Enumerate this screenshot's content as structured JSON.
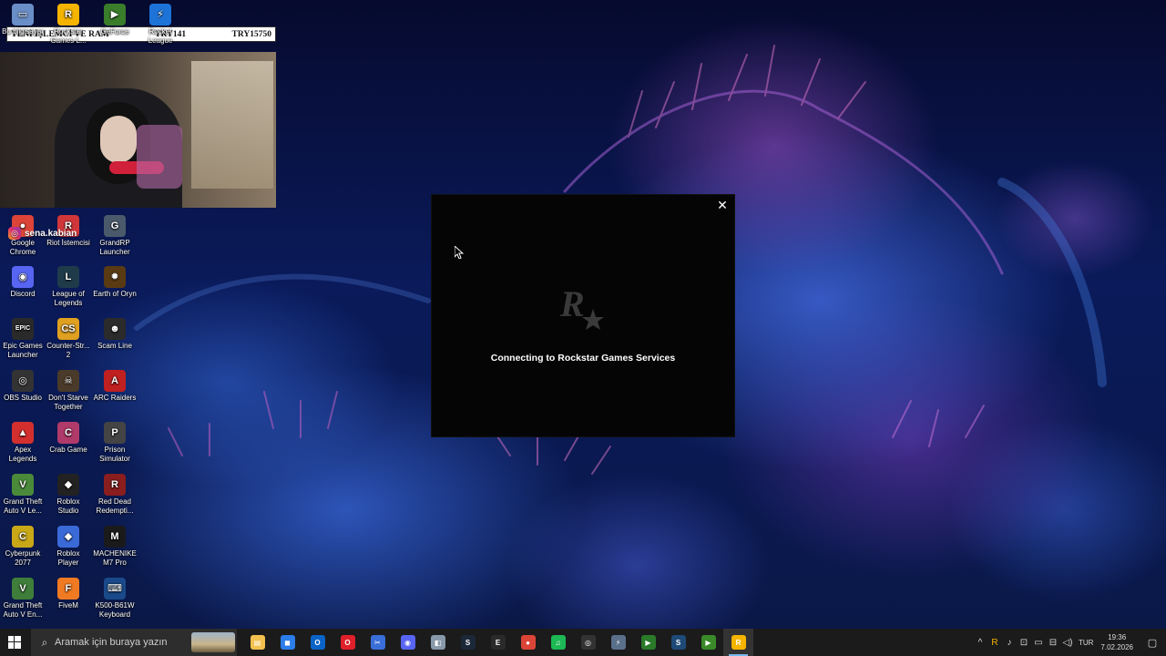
{
  "stream_overlay": {
    "title": "YENİ İŞLEMCİ VE RAM",
    "amount_current": "TRY141",
    "amount_goal": "TRY15750",
    "social_handle": "sena.kabian"
  },
  "desktop_icons": [
    {
      "label": "Bu bilgisayar",
      "glyph": "▭",
      "color": "#6a8fc8"
    },
    {
      "label": "Rockstar Games L...",
      "glyph": "R",
      "color": "#f4b400"
    },
    {
      "label": "GeForce",
      "glyph": "▶",
      "color": "#3a7d2a"
    },
    {
      "label": "Rocket League",
      "glyph": "⚡",
      "color": "#1e73d8"
    },
    {
      "label": "Google Chrome",
      "glyph": "●",
      "color": "#db4437"
    },
    {
      "label": "Riot İstemcisi",
      "glyph": "R",
      "color": "#d13639"
    },
    {
      "label": "GrandRP Launcher",
      "glyph": "G",
      "color": "#4b5a6b"
    },
    {
      "label": "Discord",
      "glyph": "◉",
      "color": "#5865f2"
    },
    {
      "label": "League of Legends",
      "glyph": "L",
      "color": "#1f3b4a"
    },
    {
      "label": "Earth of Oryn",
      "glyph": "✹",
      "color": "#5a3a12"
    },
    {
      "label": "Epic Games Launcher",
      "glyph": "EPIC",
      "color": "#2a2a2a"
    },
    {
      "label": "Counter-Str... 2",
      "glyph": "CS",
      "color": "#e0a020"
    },
    {
      "label": "Scam Line",
      "glyph": "☻",
      "color": "#2b2b2b"
    },
    {
      "label": "OBS Studio",
      "glyph": "◎",
      "color": "#333"
    },
    {
      "label": "Don't Starve Together",
      "glyph": "☠",
      "color": "#4a3a2a"
    },
    {
      "label": "ARC Raiders",
      "glyph": "A",
      "color": "#c02020"
    },
    {
      "label": "Apex Legends",
      "glyph": "▲",
      "color": "#d32f2f"
    },
    {
      "label": "Crab Game",
      "glyph": "C",
      "color": "#b03a6a"
    },
    {
      "label": "Prison Simulator",
      "glyph": "P",
      "color": "#444"
    },
    {
      "label": "Grand Theft Auto V Le...",
      "glyph": "V",
      "color": "#4b8a3a"
    },
    {
      "label": "Roblox Studio",
      "glyph": "◆",
      "color": "#222"
    },
    {
      "label": "Red Dead Redempti...",
      "glyph": "R",
      "color": "#8a1d1d"
    },
    {
      "label": "Cyberpunk 2077",
      "glyph": "C",
      "color": "#c9a818"
    },
    {
      "label": "Roblox Player",
      "glyph": "◆",
      "color": "#3a6ad8"
    },
    {
      "label": "MACHENIKE M7 Pro",
      "glyph": "M",
      "color": "#1a1a1a"
    },
    {
      "label": "Grand Theft Auto V En...",
      "glyph": "V",
      "color": "#3f7d3a"
    },
    {
      "label": "FiveM",
      "glyph": "F",
      "color": "#f07a22"
    },
    {
      "label": "K500-B61W Keyboard",
      "glyph": "⌨",
      "color": "#1a4a8a"
    }
  ],
  "dialog": {
    "logo_text": "R",
    "status": "Connecting to Rockstar Games Services",
    "close_symbol": "✕"
  },
  "taskbar": {
    "search_placeholder": "Aramak için buraya yazın",
    "apps": [
      {
        "name": "file-explorer",
        "glyph": "▤",
        "color": "#f2c14e"
      },
      {
        "name": "microsoft-store",
        "glyph": "◼",
        "color": "#2b7de9"
      },
      {
        "name": "outlook",
        "glyph": "O",
        "color": "#0a64c8"
      },
      {
        "name": "opera",
        "glyph": "O",
        "color": "#e0202a"
      },
      {
        "name": "snipping-tool",
        "glyph": "✂",
        "color": "#3a6ed8"
      },
      {
        "name": "discord",
        "glyph": "◉",
        "color": "#5865f2"
      },
      {
        "name": "app-launcher",
        "glyph": "◧",
        "color": "#8899aa"
      },
      {
        "name": "steam",
        "glyph": "S",
        "color": "#1b2838"
      },
      {
        "name": "epic-games",
        "glyph": "E",
        "color": "#2a2a2a"
      },
      {
        "name": "chrome",
        "glyph": "●",
        "color": "#db4437"
      },
      {
        "name": "spotify",
        "glyph": "♫",
        "color": "#1db954"
      },
      {
        "name": "obs-studio",
        "glyph": "◎",
        "color": "#333"
      },
      {
        "name": "rocket-league",
        "glyph": "⚡",
        "color": "#5a6f8a"
      },
      {
        "name": "media-player",
        "glyph": "▶",
        "color": "#2a7a2a"
      },
      {
        "name": "steam-2",
        "glyph": "S",
        "color": "#1e4a78"
      },
      {
        "name": "media-player-2",
        "glyph": "▶",
        "color": "#3a8a2a"
      },
      {
        "name": "rockstar-launcher",
        "glyph": "R",
        "color": "#f4b400"
      }
    ],
    "active_app": "rockstar-launcher",
    "tray_language": "TUR",
    "time": "19:36",
    "date": "7.02.2026"
  }
}
